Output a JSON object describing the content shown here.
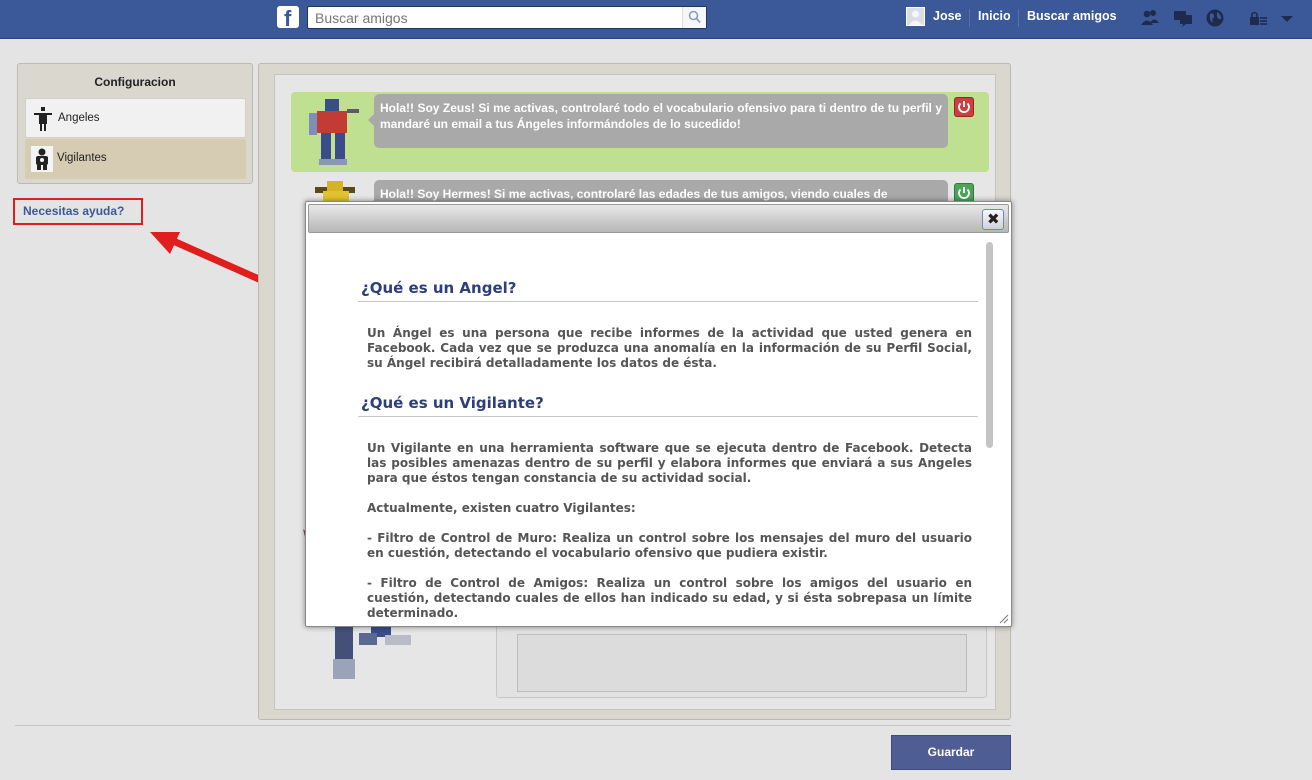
{
  "topbar": {
    "logo_letter": "f",
    "search_placeholder": "Buscar amigos",
    "user_name": "Jose",
    "home_label": "Inicio",
    "find_friends_label": "Buscar amigos",
    "bg_color": "#3b5998"
  },
  "sidebar": {
    "title": "Configuracion",
    "items": [
      {
        "label": "Angeles",
        "icon": "angel-figure-icon"
      },
      {
        "label": "Vigilantes",
        "icon": "guardian-figure-icon"
      }
    ],
    "help_link": "Necesitas ayuda?"
  },
  "main": {
    "zeus_message": "Hola!! Soy Zeus! Si me activas, controlaré todo el vocabulario ofensivo para ti dentro de tu perfil y mandaré un email a tus Ángeles informándoles de lo sucedido!",
    "hermes_message": "Hola!! Soy Hermes! Si me activas, controlaré las edades de tus amigos, viendo cuales de",
    "save_label": "Guardar",
    "zeus_status": "active",
    "hermes_status": "inactive"
  },
  "modal": {
    "heading_angel": "¿Qué es un Angel?",
    "text_angel": "Un Ángel es una persona que recibe informes de la actividad que usted genera en Facebook. Cada vez que se produzca una anomalía en la información de su Perfil Social, su Ángel recibirá detalladamente los datos de ésta.",
    "heading_vigilante": "¿Qué es un Vigilante?",
    "text_vigilante": "Un Vigilante en una herramienta software que se ejecuta dentro de Facebook. Detecta las posibles amenazas dentro de su perfil y elabora informes que enviará a sus Angeles para que éstos tengan constancia de su actividad social.",
    "text_count": "Actualmente, existen cuatro Vigilantes:",
    "text_filter_wall": "- Filtro de Control de Muro: Realiza un control sobre los mensajes del muro del usuario en cuestión, detectando el vocabulario ofensivo que pudiera existir.",
    "text_filter_friends": "- Filtro de Control de Amigos: Realiza un control sobre los amigos del usuario en cuestión, detectando cuales de ellos han indicado su edad, y si ésta sobrepasa un límite determinado.",
    "close_glyph": "✖"
  },
  "colors": {
    "accent": "#3b5998",
    "zeus_card": "#bfe091",
    "bubble": "#a9a9a9",
    "power_red": "#c84040",
    "power_green": "#4da35a",
    "save_button": "#4e5d94",
    "annotation_red": "#e01e1e"
  }
}
